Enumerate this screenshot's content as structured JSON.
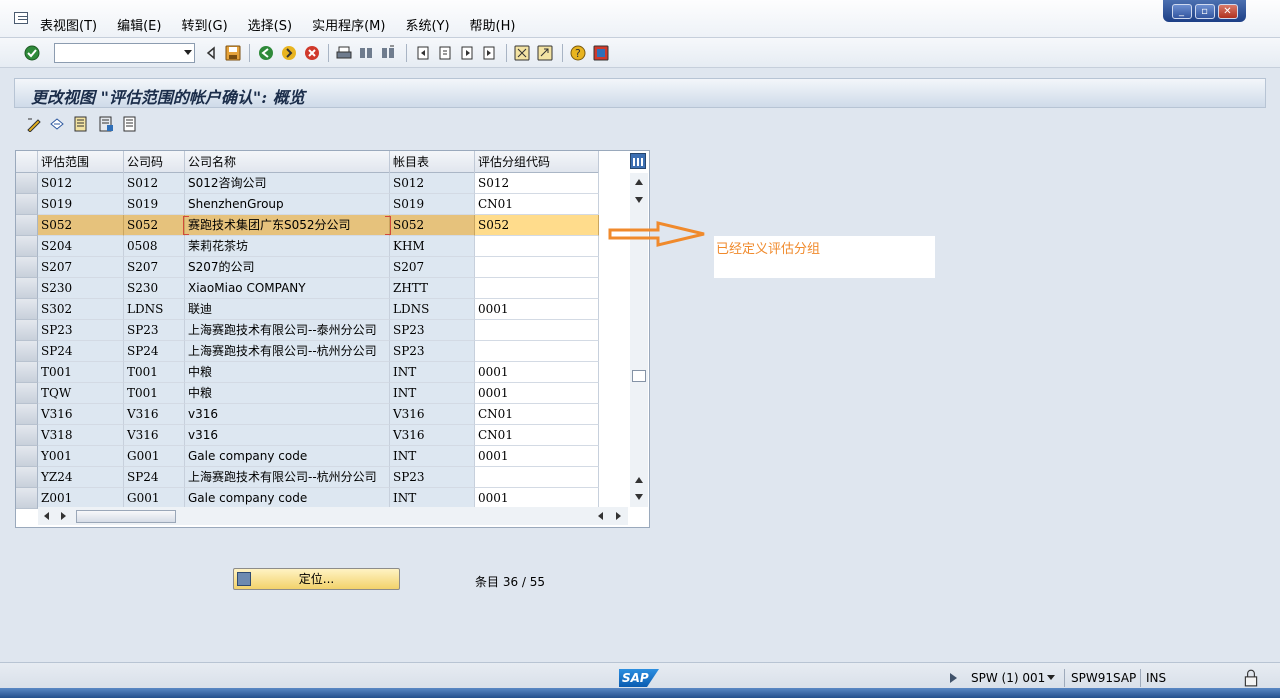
{
  "menu": {
    "items": [
      "表视图(T)",
      "编辑(E)",
      "转到(G)",
      "选择(S)",
      "实用程序(M)",
      "系统(Y)",
      "帮助(H)"
    ]
  },
  "window_controls": {
    "minimize": "_",
    "restore": "▫",
    "close": "✕"
  },
  "command_field": {
    "value": ""
  },
  "page": {
    "title": "更改视图 \"评估范围的帐户确认\": 概览"
  },
  "table": {
    "headers": [
      "评估范围",
      "公司码",
      "公司名称",
      "帐目表",
      "评估分组代码"
    ],
    "rows": [
      [
        "S012",
        "S012",
        "S012咨询公司",
        "S012",
        "S012"
      ],
      [
        "S019",
        "S019",
        "ShenzhenGroup",
        "S019",
        "CN01"
      ],
      [
        "S052",
        "S052",
        "赛跑技术集团广东S052分公司",
        "S052",
        "S052"
      ],
      [
        "S204",
        "0508",
        "茉莉花茶坊",
        "KHM",
        ""
      ],
      [
        "S207",
        "S207",
        "S207的公司",
        "S207",
        ""
      ],
      [
        "S230",
        "S230",
        "XiaoMiao COMPANY",
        "ZHTT",
        ""
      ],
      [
        "S302",
        "LDNS",
        "联迪",
        "LDNS",
        "0001"
      ],
      [
        "SP23",
        "SP23",
        "上海赛跑技术有限公司--泰州分公司",
        "SP23",
        ""
      ],
      [
        "SP24",
        "SP24",
        "上海赛跑技术有限公司--杭州分公司",
        "SP23",
        ""
      ],
      [
        "T001",
        "T001",
        "中粮",
        "INT",
        "0001"
      ],
      [
        "TQW",
        "T001",
        "中粮",
        "INT",
        "0001"
      ],
      [
        "V316",
        "V316",
        "v316",
        "V316",
        "CN01"
      ],
      [
        "V318",
        "V316",
        "v316",
        "V316",
        "CN01"
      ],
      [
        "Y001",
        "G001",
        "Gale  company code",
        "INT",
        "0001"
      ],
      [
        "YZ24",
        "SP24",
        "上海赛跑技术有限公司--杭州分公司",
        "SP23",
        ""
      ],
      [
        "Z001",
        "G001",
        "Gale  company code",
        "INT",
        "0001"
      ]
    ],
    "highlighted_row": 2
  },
  "annotation": {
    "text": "已经定义评估分组",
    "color": "#f08a2c"
  },
  "position_button": {
    "label": "定位..."
  },
  "entry_counter": "条目 36 / 55",
  "status": {
    "sap": "SAP",
    "session": "SPW (1) 001",
    "server": "SPW91SAP",
    "mode": "INS"
  }
}
